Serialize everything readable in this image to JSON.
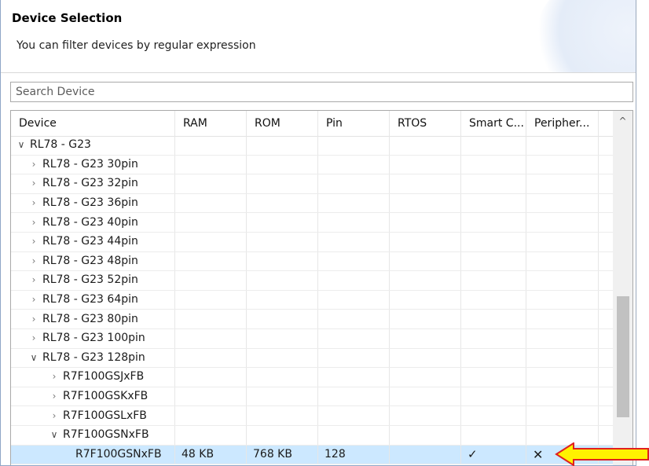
{
  "header": {
    "title": "Device Selection",
    "subtitle": "You can filter devices by regular expression"
  },
  "search": {
    "placeholder": "Search Device",
    "value": ""
  },
  "columns": [
    "Device",
    "RAM",
    "ROM",
    "Pin",
    "RTOS",
    "Smart C...",
    "Peripher..."
  ],
  "rows": [
    {
      "name": "RL78 - G23",
      "level": 0,
      "expander": "open"
    },
    {
      "name": "RL78 - G23 30pin",
      "level": 1,
      "expander": "closed"
    },
    {
      "name": "RL78 - G23 32pin",
      "level": 1,
      "expander": "closed"
    },
    {
      "name": "RL78 - G23 36pin",
      "level": 1,
      "expander": "closed"
    },
    {
      "name": "RL78 - G23 40pin",
      "level": 1,
      "expander": "closed"
    },
    {
      "name": "RL78 - G23 44pin",
      "level": 1,
      "expander": "closed"
    },
    {
      "name": "RL78 - G23 48pin",
      "level": 1,
      "expander": "closed"
    },
    {
      "name": "RL78 - G23 52pin",
      "level": 1,
      "expander": "closed"
    },
    {
      "name": "RL78 - G23 64pin",
      "level": 1,
      "expander": "closed"
    },
    {
      "name": "RL78 - G23 80pin",
      "level": 1,
      "expander": "closed"
    },
    {
      "name": "RL78 - G23 100pin",
      "level": 1,
      "expander": "closed"
    },
    {
      "name": "RL78 - G23 128pin",
      "level": 1,
      "expander": "open"
    },
    {
      "name": "R7F100GSJxFB",
      "level": 2,
      "expander": "closed"
    },
    {
      "name": "R7F100GSKxFB",
      "level": 2,
      "expander": "closed"
    },
    {
      "name": "R7F100GSLxFB",
      "level": 2,
      "expander": "closed"
    },
    {
      "name": "R7F100GSNxFB",
      "level": 2,
      "expander": "open"
    },
    {
      "name": "R7F100GSNxFB",
      "level": 3,
      "expander": "none",
      "selected": true,
      "ram": "48 KB",
      "rom": "768 KB",
      "pin": "128",
      "rtos": "",
      "smart": "✓",
      "peripheral": "✕"
    }
  ],
  "scrollbar": {
    "up_glyph": "^",
    "thumb_fraction_start": 0.52,
    "thumb_fraction_size": 0.34
  },
  "colors": {
    "selected_row": "#cce8ff",
    "arrow_fill": "#fff200",
    "arrow_stroke": "#e02020"
  }
}
